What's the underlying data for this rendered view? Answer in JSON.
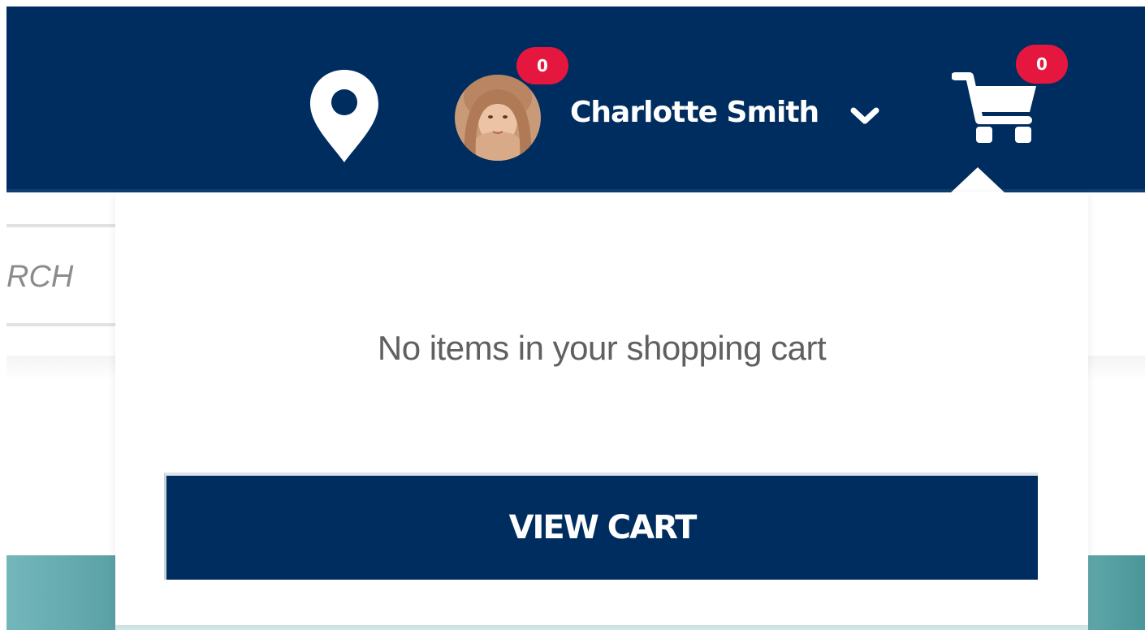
{
  "header": {
    "icons": {
      "location": "location-pin-icon",
      "chevron": "chevron-down-icon",
      "cart": "shopping-cart-icon"
    },
    "user": {
      "name": "Charlotte Smith",
      "badge_count": "0",
      "avatar": "user-avatar"
    },
    "cart": {
      "badge_count": "0"
    }
  },
  "search": {
    "visible_text": "RCH"
  },
  "cart_dropdown": {
    "empty_message": "No items in your shopping cart",
    "view_cart_label": "VIEW CART"
  },
  "colors": {
    "header_bg": "#002d5f",
    "badge": "#e5173f",
    "button_bg": "#002d5f",
    "teal": "#5aa1a6"
  }
}
